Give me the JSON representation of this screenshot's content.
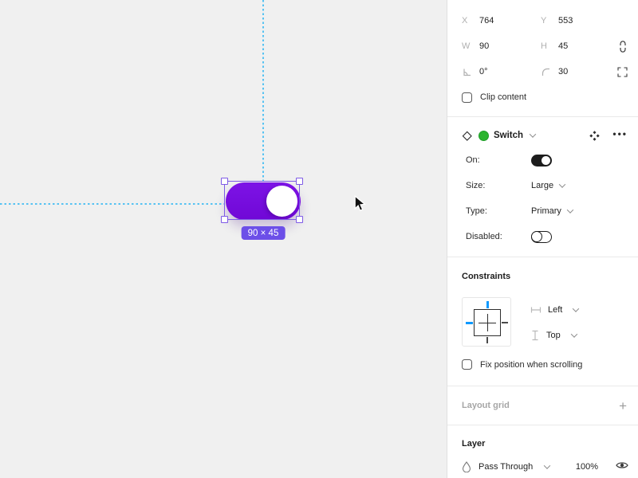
{
  "canvas": {
    "dimension_badge": "90 × 45",
    "switch": {
      "state_on": true
    }
  },
  "inspector": {
    "position": {
      "x_label": "X",
      "x_value": "764",
      "y_label": "Y",
      "y_value": "553",
      "w_label": "W",
      "w_value": "90",
      "h_label": "H",
      "h_value": "45",
      "rotation_value": "0°",
      "corner_radius_value": "30",
      "clip_content_label": "Clip content"
    },
    "component": {
      "name": "Switch",
      "more_label": "•••",
      "properties": [
        {
          "label": "On:",
          "control": "toggle",
          "value": true
        },
        {
          "label": "Size:",
          "control": "select",
          "value": "Large"
        },
        {
          "label": "Type:",
          "control": "select",
          "value": "Primary"
        },
        {
          "label": "Disabled:",
          "control": "toggle",
          "value": false
        }
      ]
    },
    "constraints": {
      "title": "Constraints",
      "horizontal_value": "Left",
      "vertical_value": "Top",
      "fix_position_label": "Fix position when scrolling"
    },
    "layout_grid": {
      "title": "Layout grid",
      "add_label": "+"
    },
    "layer": {
      "title": "Layer",
      "blend_mode": "Pass Through",
      "opacity": "100%"
    }
  },
  "icons": {
    "constrain_proportions": "broken-chain",
    "independent_corners": "corner-brackets",
    "rotation": "angle-corner",
    "corner_radius": "arc-corner",
    "component": "diamond-outline",
    "component_status": "green-dot",
    "swap_instance": "four-diamonds",
    "more_options": "ellipsis",
    "horizontal_constraint": "h-bar",
    "vertical_constraint": "i-beam",
    "blend_mode": "droplet",
    "visibility": "eye",
    "add": "plus",
    "cursor": "arrow-pointer"
  },
  "colors": {
    "switch_fill": "#7a0fe0",
    "selection": "#7e5ae6",
    "badge": "#6c4fe8",
    "guide": "#55c2f2",
    "constraint_active": "#0d99ff",
    "component_green": "#2bb42f",
    "canvas_bg": "#f0f0f0",
    "panel_bg": "#ffffff"
  }
}
